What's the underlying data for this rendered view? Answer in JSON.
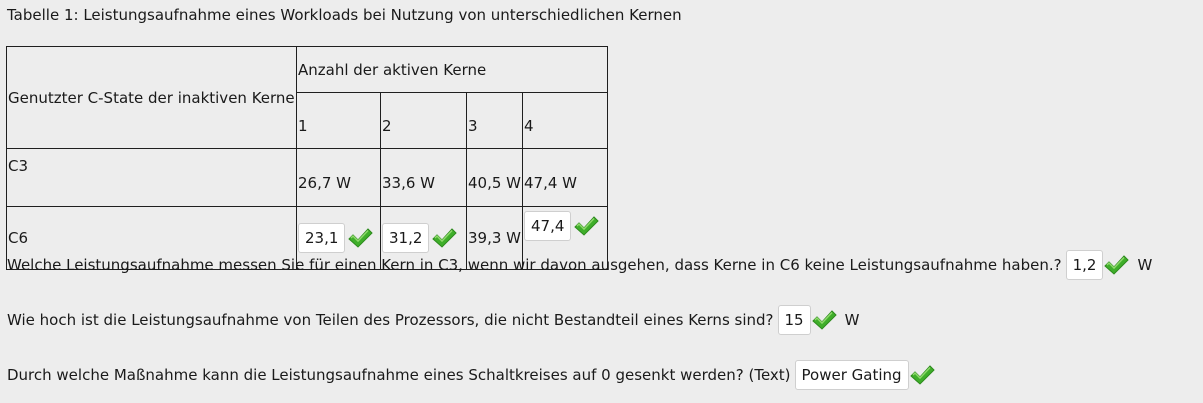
{
  "caption": "Tabelle 1: Leistungsaufnahme eines Workloads bei Nutzung von unterschiedlichen Kernen",
  "table": {
    "row_header_label": "Genutzter C-State der inaktiven Kerne",
    "group_header": "Anzahl der aktiven Kerne",
    "columns": [
      "1",
      "2",
      "3",
      "4"
    ],
    "rows": [
      {
        "label": "C3",
        "cells": [
          "26,7 W",
          "33,6 W",
          "40,5 W",
          "47,4 W"
        ]
      },
      {
        "label": "C6",
        "cells": [
          "23,1",
          "31,2",
          "39,3 W",
          "47,4"
        ]
      }
    ]
  },
  "questions": [
    {
      "text": "Welche Leistungsaufnahme messen Sie für einen Kern in C3, wenn wir davon ausgehen, dass Kerne in C6 keine Leistungsaufnahme haben.?",
      "answer": "1,2",
      "unit": "W"
    },
    {
      "text": "Wie hoch ist die Leistungsaufnahme von Teilen des Prozessors, die nicht Bestandteil eines Kerns sind?",
      "answer": "15",
      "unit": "W"
    },
    {
      "text": "Durch welche Maßnahme kann die Leistungsaufnahme eines Schaltkreises auf 0 gesenkt werden? (Text)",
      "answer": "Power Gating",
      "unit": ""
    }
  ],
  "icons": {
    "correct": "check-icon"
  },
  "colors": {
    "check": "#3fae2a",
    "check_highlight": "#8ed96b"
  }
}
